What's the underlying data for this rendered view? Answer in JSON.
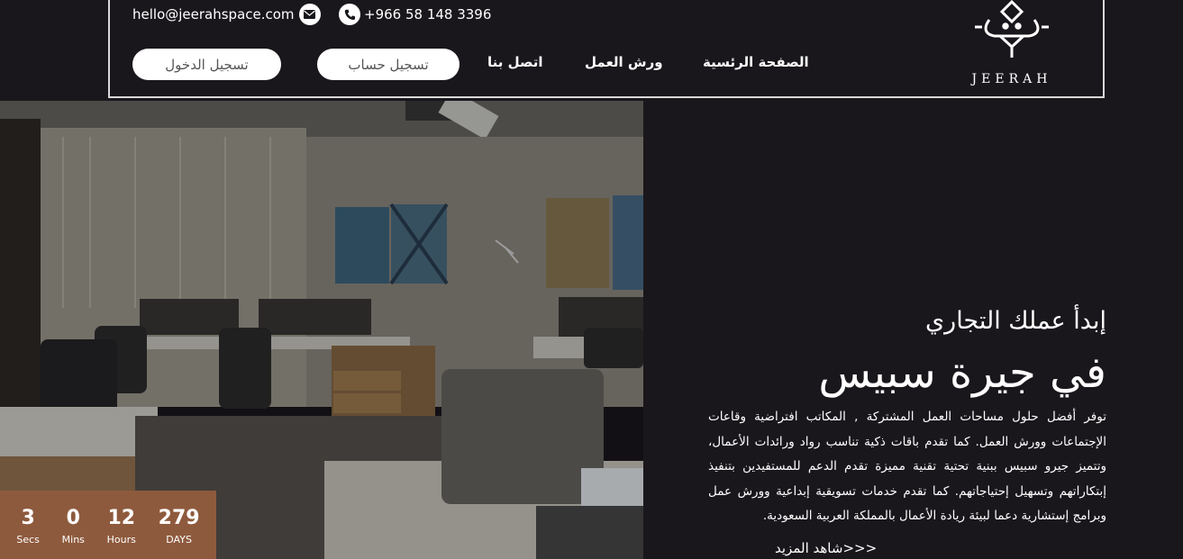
{
  "header": {
    "email": "hello@jeerahspace.com",
    "email_icon": "envelope-icon",
    "phone": "+966 58 148 3396",
    "phone_icon": "phone-icon",
    "login_label": "تسجيل الدخول",
    "signup_label": "تسجيل حساب",
    "nav": [
      "اتصل بنا",
      "ورش العمل",
      "الصفحة الرئسية"
    ],
    "logo_text": "JEERAH"
  },
  "hero": {
    "sub_heading": "إبدأ عملك التجاري",
    "main_heading": "في جيرة سبيس",
    "description": "توفر أفضل حلول مساحات العمل المشتركة , المكاتب افتراضية وقاعات الإجتماعات وورش العمل. كما تقدم باقات ذكية تناسب رواد ورائدات الأعمال، وتتميز جيرو سبيس ببنية تحتية تقنية مميزة تقدم الدعم للمستفيدين بتنفيذ إبتكاراتهم وتسهيل إحتياجاتهم. كما تقدم خدمات تسويقية إبداعية وورش عمل وبرامج إستشارية دعما لبيئة ريادة الأعمال بالمملكة العربية السعودية.",
    "more_link": "شاهد المزيد>>>"
  },
  "countdown": {
    "days": "279",
    "days_label": "DAYS",
    "hours": "12",
    "hours_label": "Hours",
    "mins": "0",
    "mins_label": "Mins",
    "secs": "3",
    "secs_label": "Secs"
  },
  "colors": {
    "background": "#1a171c",
    "countdown_bg": "#8e5a3d",
    "button_bg": "#ffffff"
  }
}
